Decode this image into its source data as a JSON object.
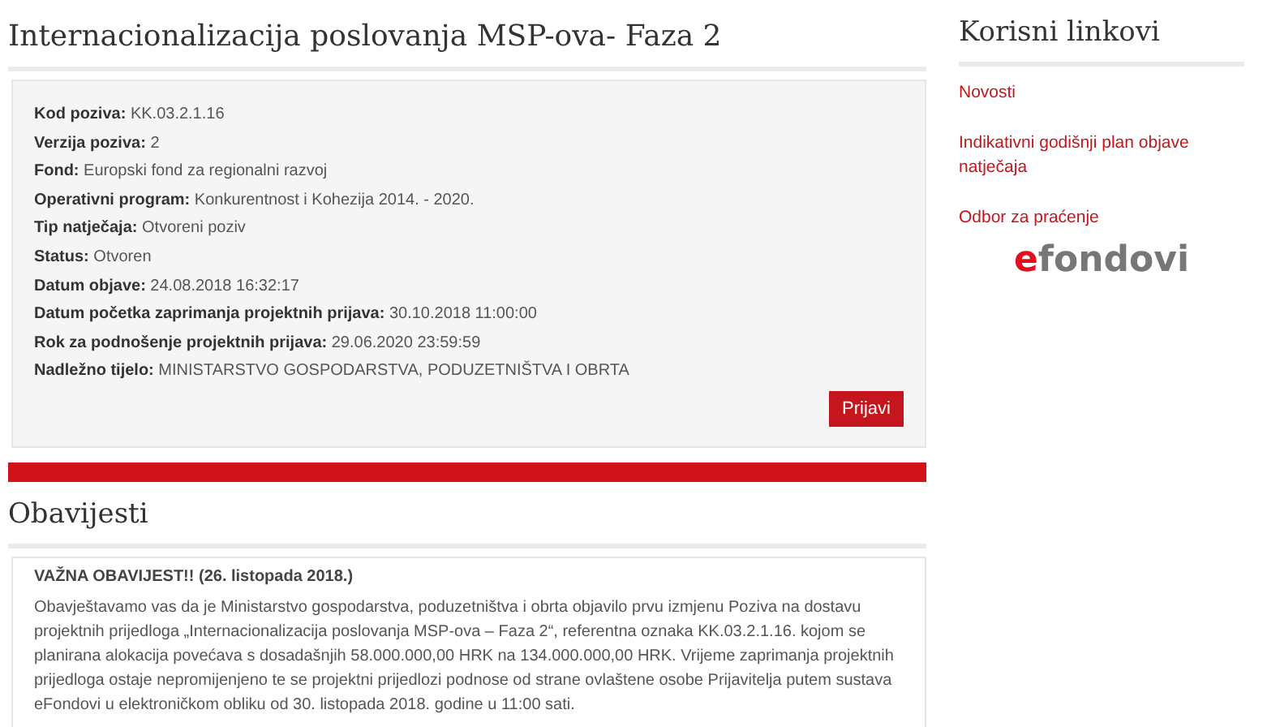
{
  "title": "Internacionalizacija poslovanja MSP-ova- Faza 2",
  "details": [
    {
      "label": "Kod poziva:",
      "value": "KK.03.2.1.16"
    },
    {
      "label": "Verzija poziva:",
      "value": "2"
    },
    {
      "label": "Fond:",
      "value": "Europski fond za regionalni razvoj"
    },
    {
      "label": "Operativni program:",
      "value": "Konkurentnost i Kohezija 2014. - 2020."
    },
    {
      "label": "Tip natječaja:",
      "value": "Otvoreni poziv"
    },
    {
      "label": "Status:",
      "value": "Otvoren"
    },
    {
      "label": "Datum objave:",
      "value": "24.08.2018 16:32:17"
    },
    {
      "label": "Datum početka zaprimanja projektnih prijava:",
      "value": "30.10.2018 11:00:00"
    },
    {
      "label": "Rok za podnošenje projektnih prijava:",
      "value": "29.06.2020 23:59:59"
    },
    {
      "label": "Nadležno tijelo:",
      "value": "MINISTARSTVO GOSPODARSTVA, PODUZETNIŠTVA I OBRTA"
    }
  ],
  "apply_button": "Prijavi",
  "notices": {
    "heading": "Obavijesti",
    "title": "VAŽNA OBAVIJEST!! (26. listopada 2018.)",
    "text": "Obavještavamo vas da je Ministarstvo gospodarstva, poduzetništva i obrta objavilo prvu izmjenu Poziva na dostavu projektnih prijedloga „Internacionalizacija poslovanja MSP-ova – Faza 2“, referentna oznaka KK.03.2.1.16. kojom se planirana alokacija povećava s dosadašnjih 58.000.000,00 HRK na 134.000.000,00 HRK. Vrijeme zaprimanja projektnih prijedloga ostaje nepromijenjeno te se projektni prijedlozi podnose od strane ovlaštene osobe Prijavitelja putem sustava eFondovi u elektroničkom obliku od 30. listopada 2018. godine u 11:00 sati."
  },
  "sidebar": {
    "heading": "Korisni linkovi",
    "links": [
      "Novosti",
      "Indikativni godišnji plan objave natječaja",
      "Odbor za praćenje"
    ],
    "logo": "efondovi"
  }
}
